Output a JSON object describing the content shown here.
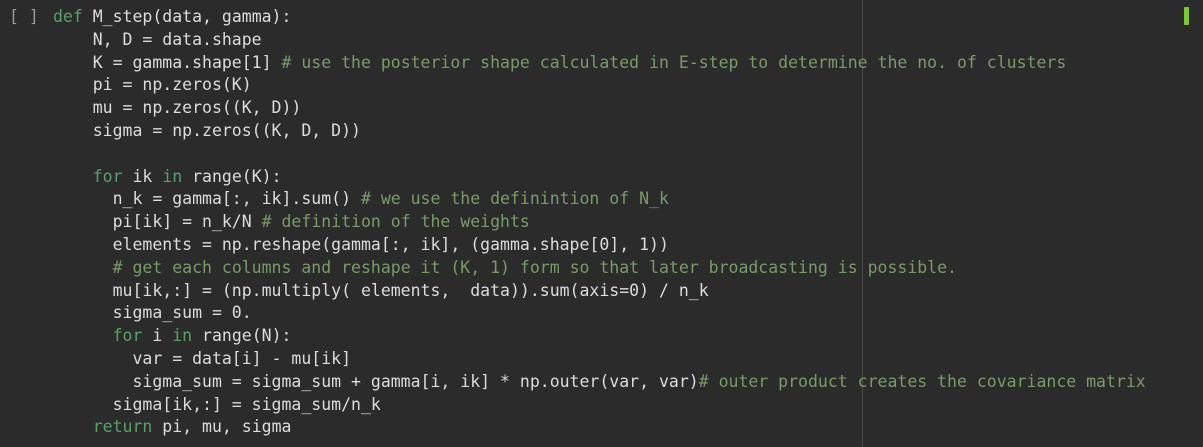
{
  "cell": {
    "run_indicator": "[ ]",
    "lines": [
      {
        "segs": [
          {
            "t": "def",
            "c": "kw"
          },
          {
            "t": " M_step(data, gamma):"
          }
        ]
      },
      {
        "segs": [
          {
            "t": "    N, D = data.shape"
          }
        ]
      },
      {
        "segs": [
          {
            "t": "    K = gamma.shape[1] "
          },
          {
            "t": "# use the posterior shape calculated in E-step to determine the no. of clusters",
            "c": "cm"
          }
        ]
      },
      {
        "segs": [
          {
            "t": "    pi = np.zeros(K)"
          }
        ]
      },
      {
        "segs": [
          {
            "t": "    mu = np.zeros((K, D))"
          }
        ]
      },
      {
        "segs": [
          {
            "t": "    sigma = np.zeros((K, D, D))"
          }
        ]
      },
      {
        "segs": [
          {
            "t": ""
          }
        ]
      },
      {
        "segs": [
          {
            "t": "    "
          },
          {
            "t": "for",
            "c": "kw"
          },
          {
            "t": " ik "
          },
          {
            "t": "in",
            "c": "kw"
          },
          {
            "t": " range(K):"
          }
        ]
      },
      {
        "segs": [
          {
            "t": "      n_k = gamma[:, ik].sum() "
          },
          {
            "t": "# we use the definintion of N_k",
            "c": "cm"
          }
        ]
      },
      {
        "segs": [
          {
            "t": "      pi[ik] = n_k/N "
          },
          {
            "t": "# definition of the weights",
            "c": "cm"
          }
        ]
      },
      {
        "segs": [
          {
            "t": "      elements = np.reshape(gamma[:, ik], (gamma.shape[0], 1))"
          }
        ]
      },
      {
        "segs": [
          {
            "t": "      "
          },
          {
            "t": "# get each columns and reshape it (K, 1) form so that later broadcasting is possible.",
            "c": "cm"
          }
        ]
      },
      {
        "segs": [
          {
            "t": "      mu[ik,:] = (np.multiply( elements,  data)).sum(axis=0) / n_k"
          }
        ]
      },
      {
        "segs": [
          {
            "t": "      sigma_sum = 0."
          }
        ]
      },
      {
        "segs": [
          {
            "t": "      "
          },
          {
            "t": "for",
            "c": "kw"
          },
          {
            "t": " i "
          },
          {
            "t": "in",
            "c": "kw"
          },
          {
            "t": " range(N):"
          }
        ]
      },
      {
        "segs": [
          {
            "t": "        var = data[i] - mu[ik]"
          }
        ]
      },
      {
        "segs": [
          {
            "t": "        sigma_sum = sigma_sum + gamma[i, ik] * np.outer(var, var)"
          },
          {
            "t": "# outer product creates the covariance matrix",
            "c": "cm"
          }
        ]
      },
      {
        "segs": [
          {
            "t": "      sigma[ik,:] = sigma_sum/n_k"
          }
        ]
      },
      {
        "segs": [
          {
            "t": "    "
          },
          {
            "t": "return",
            "c": "kw"
          },
          {
            "t": " pi, mu, sigma"
          }
        ]
      }
    ]
  },
  "colors": {
    "background": "#2b2b2b",
    "text": "#dcdcdc",
    "keyword": "#5aa06a",
    "comment": "#7a9a6a",
    "ruler": "#4a4a4a",
    "scroll_marker": "#7cc43a"
  }
}
